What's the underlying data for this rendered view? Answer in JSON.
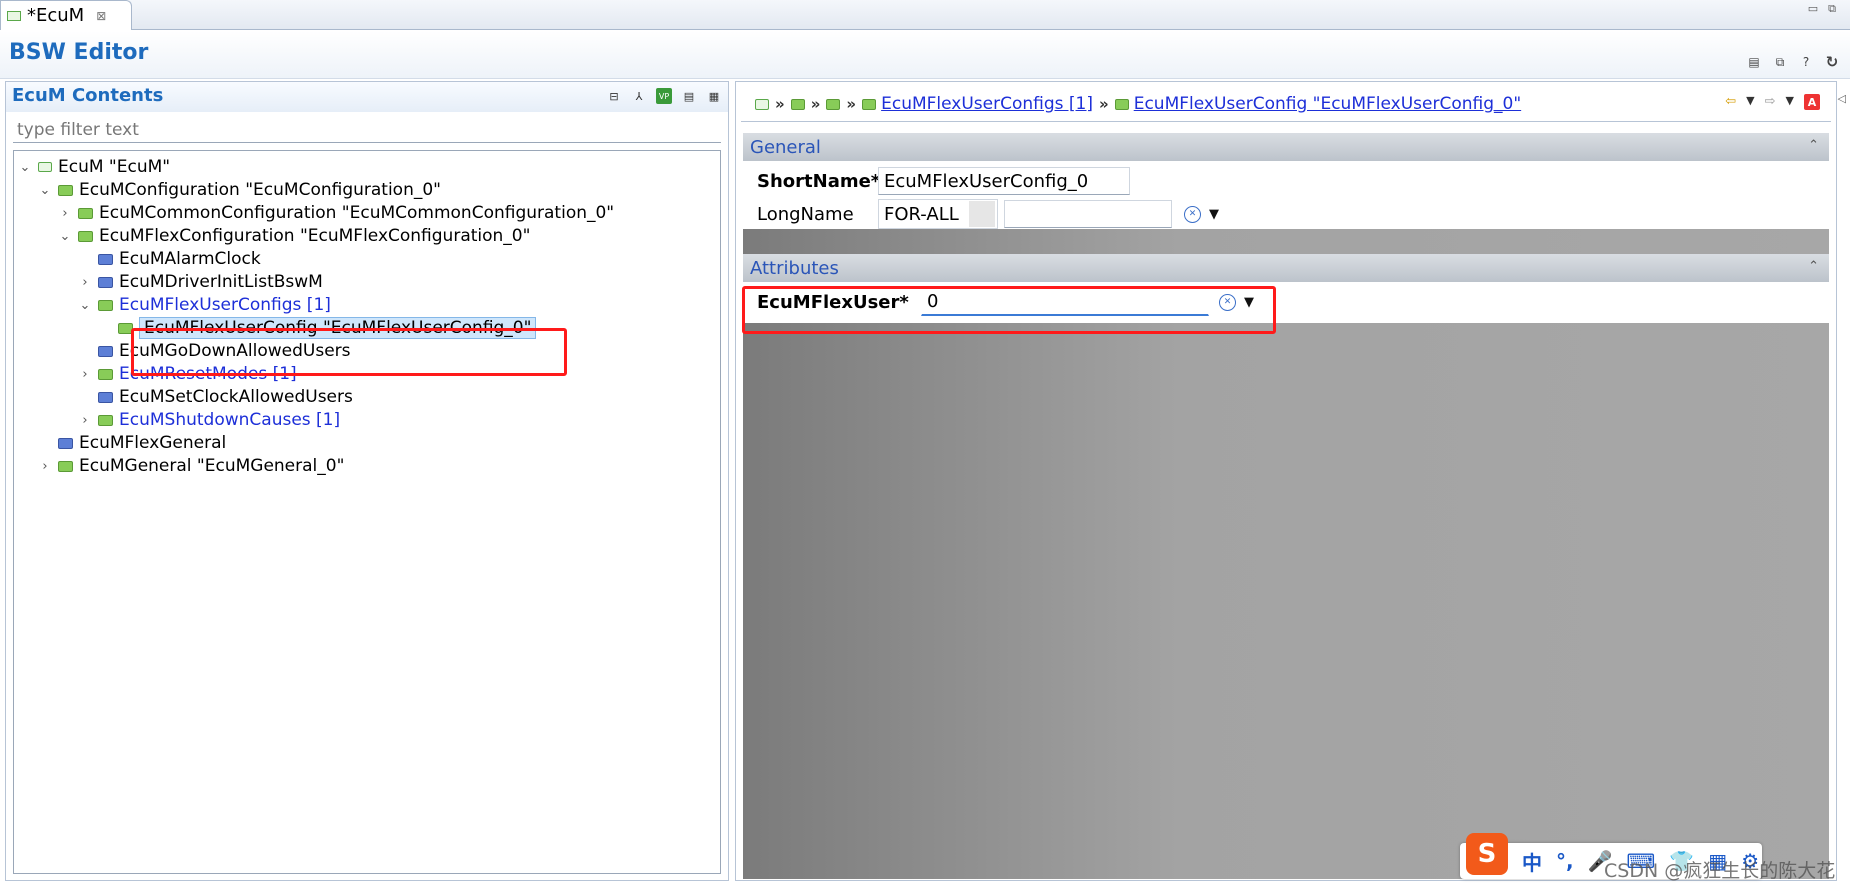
{
  "tab": {
    "label": "*EcuM",
    "close": "⊠"
  },
  "window": {
    "minimize": "▭",
    "maximize": "⧉"
  },
  "editor": {
    "title": "BSW Editor"
  },
  "left_panel": {
    "title": "EcuM Contents",
    "filter_placeholder": "type filter text",
    "tools": [
      "collapse-all-icon",
      "hierarchy-icon",
      "vp-res-icon",
      "page-icon",
      "table-icon"
    ],
    "tree": [
      {
        "label": "EcuM \"EcuM\"",
        "depth": 0,
        "twist": "⌄",
        "icon": "module",
        "link": false
      },
      {
        "label": "EcuMConfiguration \"EcuMConfiguration_0\"",
        "depth": 1,
        "twist": "⌄",
        "icon": "green",
        "link": false
      },
      {
        "label": "EcuMCommonConfiguration \"EcuMCommonConfiguration_0\"",
        "depth": 2,
        "twist": "›",
        "icon": "green",
        "link": false
      },
      {
        "label": "EcuMFlexConfiguration \"EcuMFlexConfiguration_0\"",
        "depth": 2,
        "twist": "⌄",
        "icon": "green",
        "link": false
      },
      {
        "label": "EcuMAlarmClock",
        "depth": 3,
        "twist": "",
        "icon": "blue",
        "link": false
      },
      {
        "label": "EcuMDriverInitListBswM",
        "depth": 3,
        "twist": "›",
        "icon": "blue",
        "link": false
      },
      {
        "label": "EcuMFlexUserConfigs [1]",
        "depth": 3,
        "twist": "⌄",
        "icon": "green",
        "link": true
      },
      {
        "label": "EcuMFlexUserConfig \"EcuMFlexUserConfig_0\"",
        "depth": 4,
        "twist": "",
        "icon": "green",
        "link": false,
        "selected": true
      },
      {
        "label": "EcuMGoDownAllowedUsers",
        "depth": 3,
        "twist": "",
        "icon": "blue",
        "link": false
      },
      {
        "label": "EcuMResetModes [1]",
        "depth": 3,
        "twist": "›",
        "icon": "green",
        "link": true
      },
      {
        "label": "EcuMSetClockAllowedUsers",
        "depth": 3,
        "twist": "",
        "icon": "blue",
        "link": false
      },
      {
        "label": "EcuMShutdownCauses [1]",
        "depth": 3,
        "twist": "›",
        "icon": "green",
        "link": true
      },
      {
        "label": "EcuMFlexGeneral",
        "depth": 1,
        "twist": "",
        "icon": "blue",
        "link": false
      },
      {
        "label": "EcuMGeneral \"EcuMGeneral_0\"",
        "depth": 1,
        "twist": "›",
        "icon": "green",
        "link": false
      }
    ]
  },
  "breadcrumb": {
    "link1": "EcuMFlexUserConfigs [1]",
    "link2": "EcuMFlexUserConfig \"EcuMFlexUserConfig_0\"",
    "sep": "»"
  },
  "general": {
    "header": "General",
    "short_name_label": "ShortName*",
    "short_name_value": "EcuMFlexUserConfig_0",
    "long_name_label": "LongName",
    "long_name_lang": "FOR-ALL",
    "long_name_value": ""
  },
  "attributes": {
    "header": "Attributes",
    "flex_user_label": "EcuMFlexUser*",
    "flex_user_value": "0"
  },
  "ime": {
    "logo": "S",
    "items": [
      "中",
      "°,",
      "🎤",
      "⌨",
      "👕",
      "▦",
      "⚙"
    ]
  },
  "watermark": "CSDN @疯狂生长的陈大花",
  "colors": {
    "accent": "#1e6bbd",
    "link": "#1d2fd8",
    "highlight": "#ff1a1a"
  }
}
